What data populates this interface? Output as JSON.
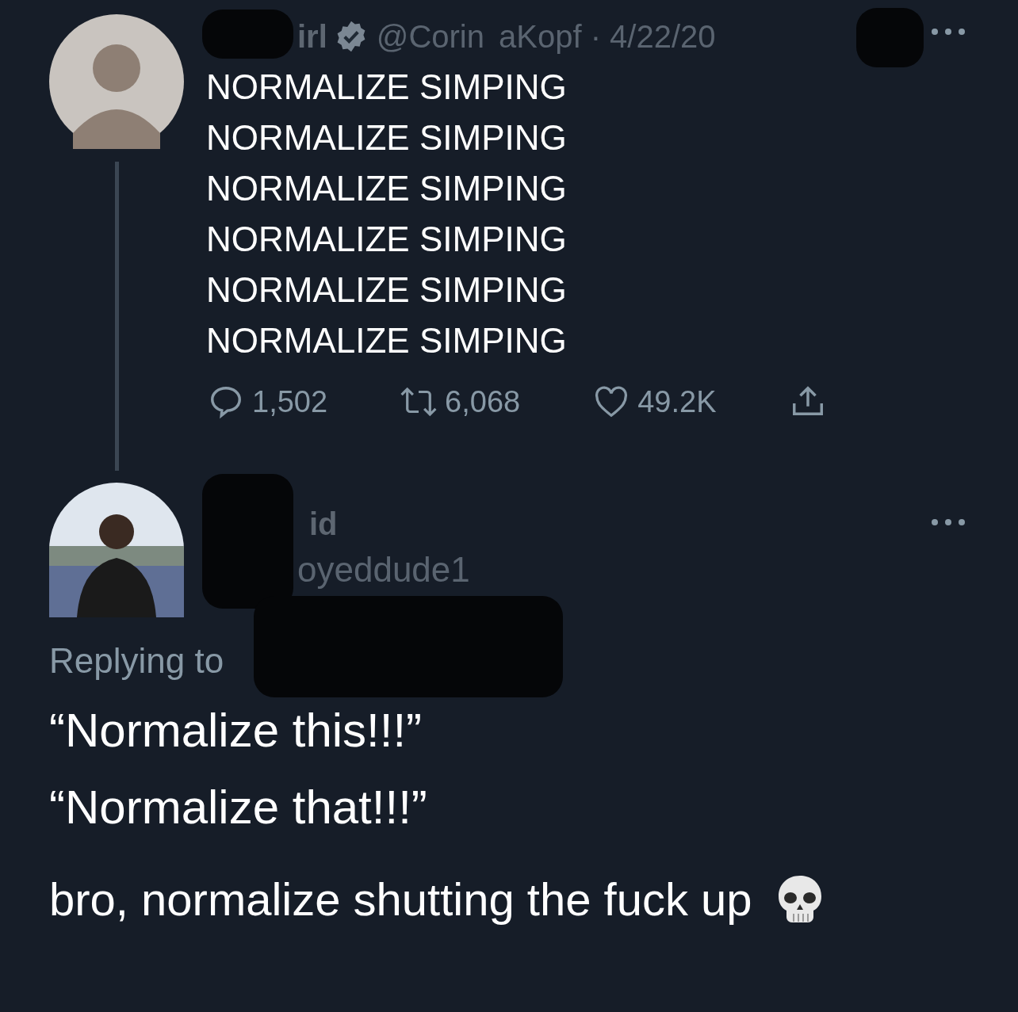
{
  "tweet": {
    "name_fragment": "irl",
    "verified": true,
    "handle_fragment": "@Corin",
    "handle_rest": "aKopf · 4/22/20",
    "lines": [
      "NORMALIZE SIMPING",
      "NORMALIZE SIMPING",
      "NORMALIZE SIMPING",
      "NORMALIZE SIMPING",
      "NORMALIZE SIMPING",
      "NORMALIZE SIMPING"
    ],
    "actions": [
      {
        "kind": "reply",
        "count": "1,502"
      },
      {
        "kind": "retweet",
        "count": "6,068"
      },
      {
        "kind": "like",
        "count": "49.2K"
      },
      {
        "kind": "share"
      }
    ]
  },
  "reply": {
    "name_fragment": "id",
    "handle_fragment": "oyeddude1",
    "replying_to": "Replying to",
    "paragraphs": [
      "“Normalize this!!!”",
      "“Normalize that!!!”",
      "bro, normalize shutting the fuck up"
    ]
  }
}
